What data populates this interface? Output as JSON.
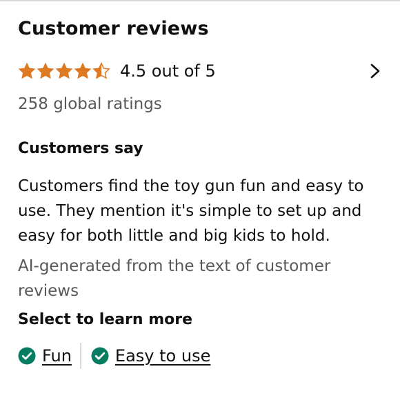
{
  "reviews": {
    "title": "Customer reviews",
    "stars_filled_fraction": 0.9,
    "rating_text": "4.5 out of 5",
    "global_ratings": "258 global ratings",
    "star_color": "#de7921",
    "chevron_icon": "chevron-right-icon"
  },
  "customers_say": {
    "title": "Customers say",
    "summary": "Customers find the toy gun fun and easy to use. They mention it's simple to set up and easy for both little and big kids to hold.",
    "ai_note": "AI-generated from the text of customer reviews"
  },
  "learn_more": {
    "title": "Select to learn more",
    "check_color": "#067d62",
    "aspects": [
      {
        "label": "Fun",
        "icon": "check-circle-icon"
      },
      {
        "label": "Easy to use",
        "icon": "check-circle-icon"
      }
    ]
  }
}
